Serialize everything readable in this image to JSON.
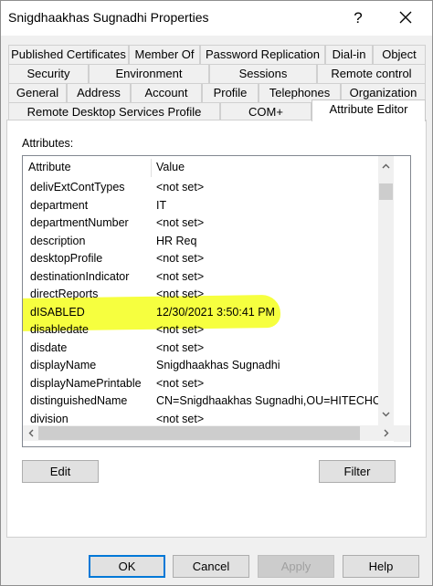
{
  "window": {
    "title": "Snigdhaakhas Sugnadhi Properties",
    "help_glyph": "?",
    "close_icon": "close-icon"
  },
  "tabs": {
    "row1": [
      "Published Certificates",
      "Member Of",
      "Password Replication",
      "Dial-in",
      "Object"
    ],
    "row2": [
      "Security",
      "Environment",
      "Sessions",
      "Remote control"
    ],
    "row3": [
      "General",
      "Address",
      "Account",
      "Profile",
      "Telephones",
      "Organization"
    ],
    "row4": [
      "Remote Desktop Services Profile",
      "COM+",
      "Attribute Editor"
    ],
    "active": "Attribute Editor"
  },
  "attributes_panel": {
    "label": "Attributes:",
    "columns": [
      "Attribute",
      "Value"
    ],
    "rows": [
      {
        "name": "delivExtContTypes",
        "value": "<not set>"
      },
      {
        "name": "department",
        "value": "IT"
      },
      {
        "name": "departmentNumber",
        "value": "<not set>"
      },
      {
        "name": "description",
        "value": "HR Req"
      },
      {
        "name": "desktopProfile",
        "value": "<not set>"
      },
      {
        "name": "destinationIndicator",
        "value": "<not set>"
      },
      {
        "name": "directReports",
        "value": "<not set>"
      },
      {
        "name": "dISABLED",
        "value": "12/30/2021 3:50:41 PM"
      },
      {
        "name": "disabledate",
        "value": "<not set>"
      },
      {
        "name": "disdate",
        "value": "<not set>"
      },
      {
        "name": "displayName",
        "value": "Snigdhaakhas Sugnadhi"
      },
      {
        "name": "displayNamePrintable",
        "value": "<not set>"
      },
      {
        "name": "distinguishedName",
        "value": "CN=Snigdhaakhas Sugnadhi,OU=HITECHC"
      },
      {
        "name": "division",
        "value": "<not set>"
      }
    ],
    "highlight_color": "#f5ff2a",
    "edit_label": "Edit",
    "filter_label": "Filter"
  },
  "footer": {
    "ok_label": "OK",
    "cancel_label": "Cancel",
    "apply_label": "Apply",
    "help_label": "Help"
  }
}
